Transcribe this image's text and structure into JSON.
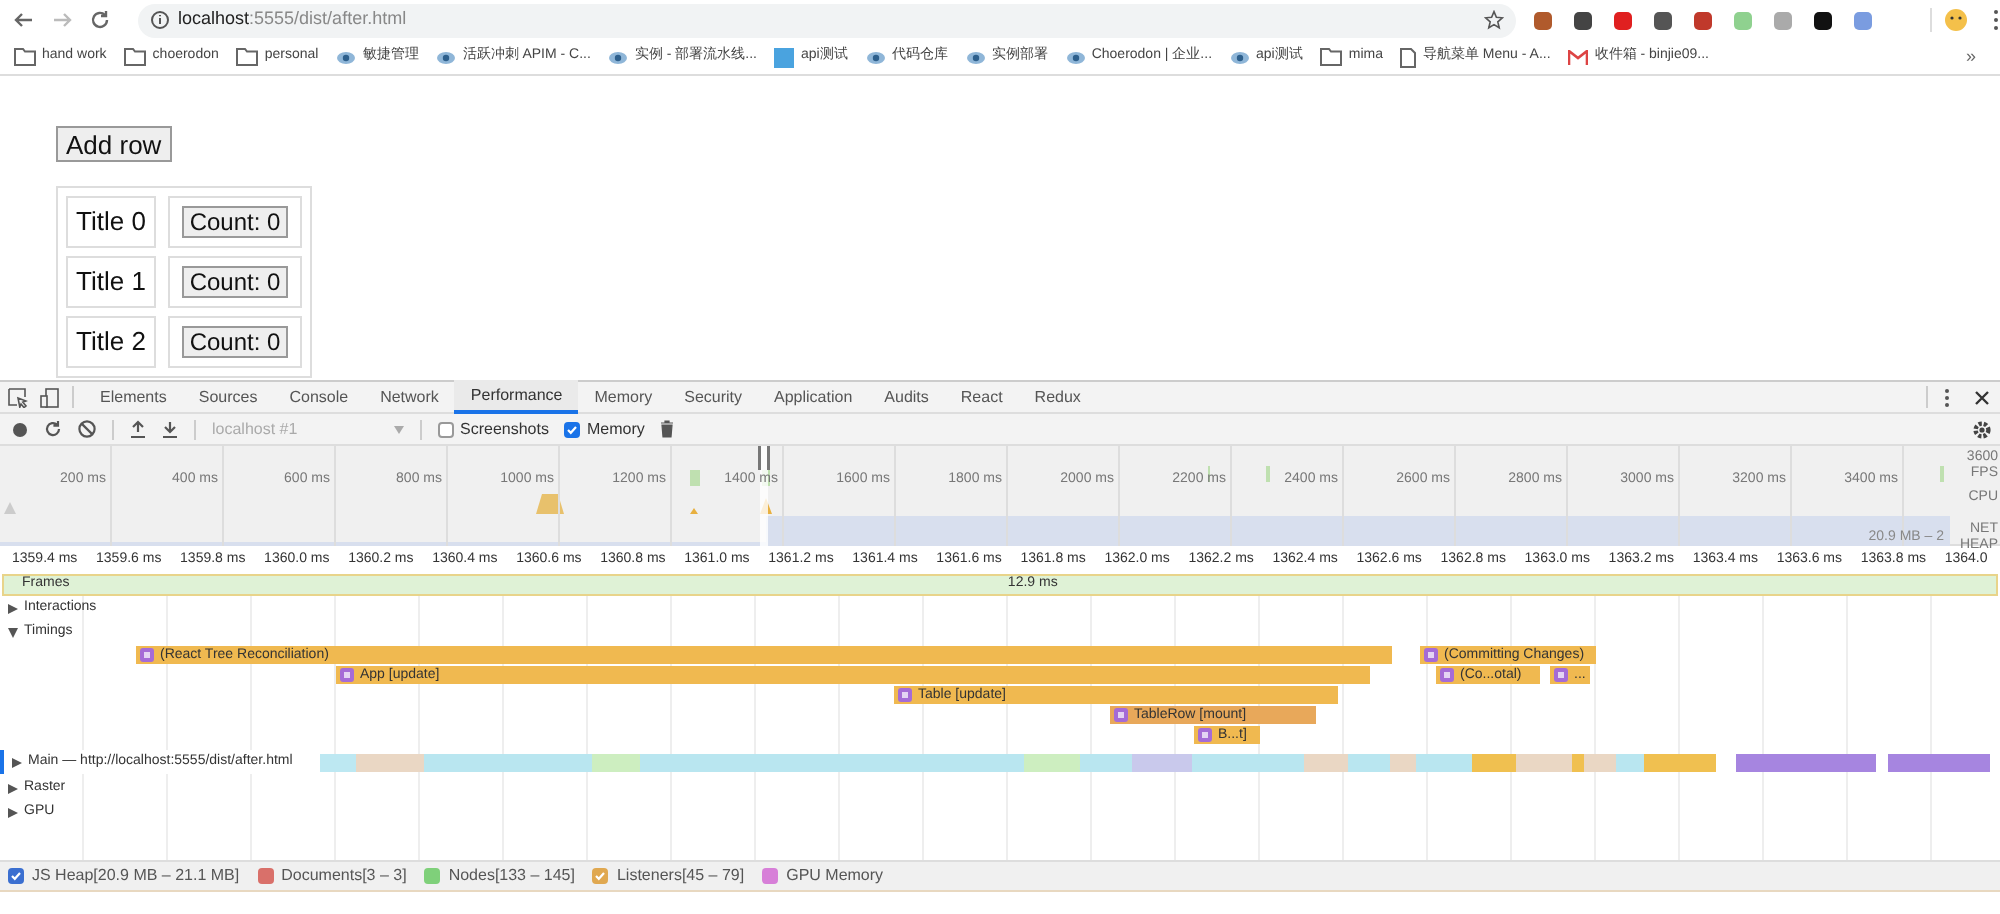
{
  "browser": {
    "url_host": "localhost",
    "url_rest": ":5555/dist/after.html",
    "bookmarks": [
      {
        "kind": "folder",
        "label": "hand work"
      },
      {
        "kind": "folder",
        "label": "choerodon"
      },
      {
        "kind": "folder",
        "label": "personal"
      },
      {
        "kind": "site",
        "label": "敏捷管理"
      },
      {
        "kind": "site",
        "label": "活跃冲刺 APIM - C..."
      },
      {
        "kind": "site",
        "label": "实例 - 部署流水线..."
      },
      {
        "kind": "app",
        "label": "api测试"
      },
      {
        "kind": "site",
        "label": "代码仓库"
      },
      {
        "kind": "site",
        "label": "实例部署"
      },
      {
        "kind": "site",
        "label": "Choerodon | 企业..."
      },
      {
        "kind": "site",
        "label": "api测试"
      },
      {
        "kind": "folder",
        "label": "mima"
      },
      {
        "kind": "page",
        "label": "导航菜单 Menu - A..."
      },
      {
        "kind": "mail",
        "label": "收件箱 - binjie09..."
      }
    ],
    "more_bookmarks": "»"
  },
  "page": {
    "add_button": "Add row",
    "rows": [
      {
        "title": "Title 0",
        "count": "Count: 0"
      },
      {
        "title": "Title 1",
        "count": "Count: 0"
      },
      {
        "title": "Title 2",
        "count": "Count: 0"
      }
    ]
  },
  "devtools": {
    "tabs": [
      {
        "label": "Elements",
        "selected": false
      },
      {
        "label": "Sources",
        "selected": false
      },
      {
        "label": "Console",
        "selected": false
      },
      {
        "label": "Network",
        "selected": false
      },
      {
        "label": "Performance",
        "selected": true
      },
      {
        "label": "Memory",
        "selected": false
      },
      {
        "label": "Security",
        "selected": false
      },
      {
        "label": "Application",
        "selected": false
      },
      {
        "label": "Audits",
        "selected": false
      },
      {
        "label": "React",
        "selected": false
      },
      {
        "label": "Redux",
        "selected": false
      }
    ],
    "profile_select": "localhost #1",
    "screenshots": {
      "label": "Screenshots",
      "checked": false
    },
    "memory": {
      "label": "Memory",
      "checked": true
    },
    "overview_ticks": [
      "200 ms",
      "400 ms",
      "600 ms",
      "800 ms",
      "1000 ms",
      "1200 ms",
      "1400 ms",
      "1600 ms",
      "1800 ms",
      "2000 ms",
      "2200 ms",
      "2400 ms",
      "2600 ms",
      "2800 ms",
      "3000 ms",
      "3200 ms",
      "3400 ms"
    ],
    "overview_last_tick": "3600",
    "overview_lanes": [
      "FPS",
      "CPU",
      "NET",
      "HEAP"
    ],
    "heap_range": "20.9 MB – 2",
    "detail_ticks": [
      "1359.4 ms",
      "1359.6 ms",
      "1359.8 ms",
      "1360.0 ms",
      "1360.2 ms",
      "1360.4 ms",
      "1360.6 ms",
      "1360.8 ms",
      "1361.0 ms",
      "1361.2 ms",
      "1361.4 ms",
      "1361.6 ms",
      "1361.8 ms",
      "1362.0 ms",
      "1362.2 ms",
      "1362.4 ms",
      "1362.6 ms",
      "1362.8 ms",
      "1363.0 ms",
      "1363.2 ms",
      "1363.4 ms",
      "1363.6 ms",
      "1363.8 ms",
      "1364.0"
    ],
    "frames": {
      "label": "Frames",
      "duration": "12.9 ms"
    },
    "tracks": [
      {
        "label": "Interactions",
        "expanded": false
      },
      {
        "label": "Timings",
        "expanded": true
      }
    ],
    "timings": [
      {
        "label": "(React Tree Reconciliation)"
      },
      {
        "label": "(Committing Changes)"
      },
      {
        "label": "App [update]"
      },
      {
        "label": "(Co...otal)"
      },
      {
        "label": "..."
      },
      {
        "label": "Table [update]"
      },
      {
        "label": "TableRow [mount]"
      },
      {
        "label": "B...t]"
      }
    ],
    "main_track": {
      "label": "Main — http://localhost:5555/dist/after.html",
      "expanded": false
    },
    "other_tracks": [
      {
        "label": "Raster",
        "expanded": false
      },
      {
        "label": "GPU",
        "expanded": false
      }
    ],
    "counters": [
      {
        "label": "JS Heap[20.9 MB – 21.1 MB]",
        "color": "#3b6fd0",
        "checked": true
      },
      {
        "label": "Documents[3 – 3]",
        "color": "#d9706a",
        "checked": false
      },
      {
        "label": "Nodes[133 – 145]",
        "color": "#7fd07a",
        "checked": false
      },
      {
        "label": "Listeners[45 – 79]",
        "color": "#e0a850",
        "checked": true
      },
      {
        "label": "GPU Memory",
        "color": "#d77fd8",
        "checked": false
      }
    ]
  }
}
